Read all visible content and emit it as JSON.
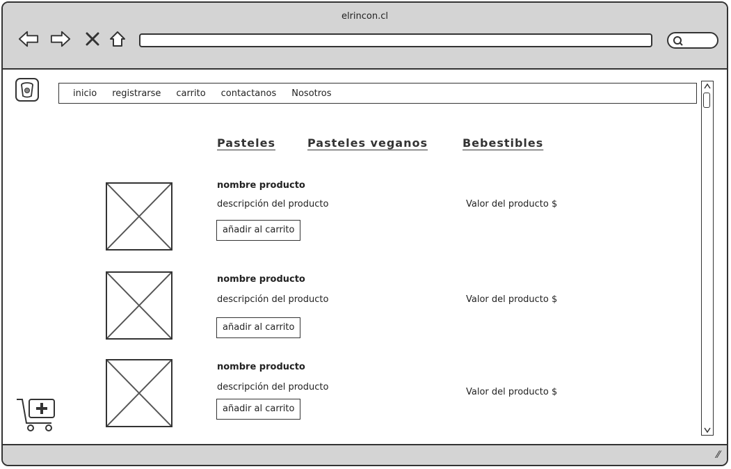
{
  "window": {
    "title": "elrincon.cl"
  },
  "nav_icons": [
    "back-arrow-icon",
    "forward-arrow-icon",
    "close-icon",
    "home-icon",
    "search-icon"
  ],
  "menu": {
    "items": [
      {
        "label": "inicio"
      },
      {
        "label": "registrarse"
      },
      {
        "label": "carrito"
      },
      {
        "label": "contactanos"
      },
      {
        "label": "Nosotros"
      }
    ]
  },
  "categories": {
    "items": [
      {
        "label": "Pasteles"
      },
      {
        "label": "Pasteles veganos"
      },
      {
        "label": "Bebestibles"
      }
    ]
  },
  "products": [
    {
      "name": "nombre producto",
      "description": "descripción del producto",
      "price": "Valor del producto $",
      "button": "añadir al carrito"
    },
    {
      "name": "nombre producto",
      "description": "descripción del producto",
      "price": "Valor del producto $",
      "button": "añadir al carrito"
    },
    {
      "name": "nombre producto",
      "description": "descripción del producto",
      "price": "Valor del producto $",
      "button": "añadir al carrito"
    }
  ],
  "colors": {
    "chrome": "#d4d4d4",
    "line": "#333333",
    "background": "#ffffff"
  }
}
